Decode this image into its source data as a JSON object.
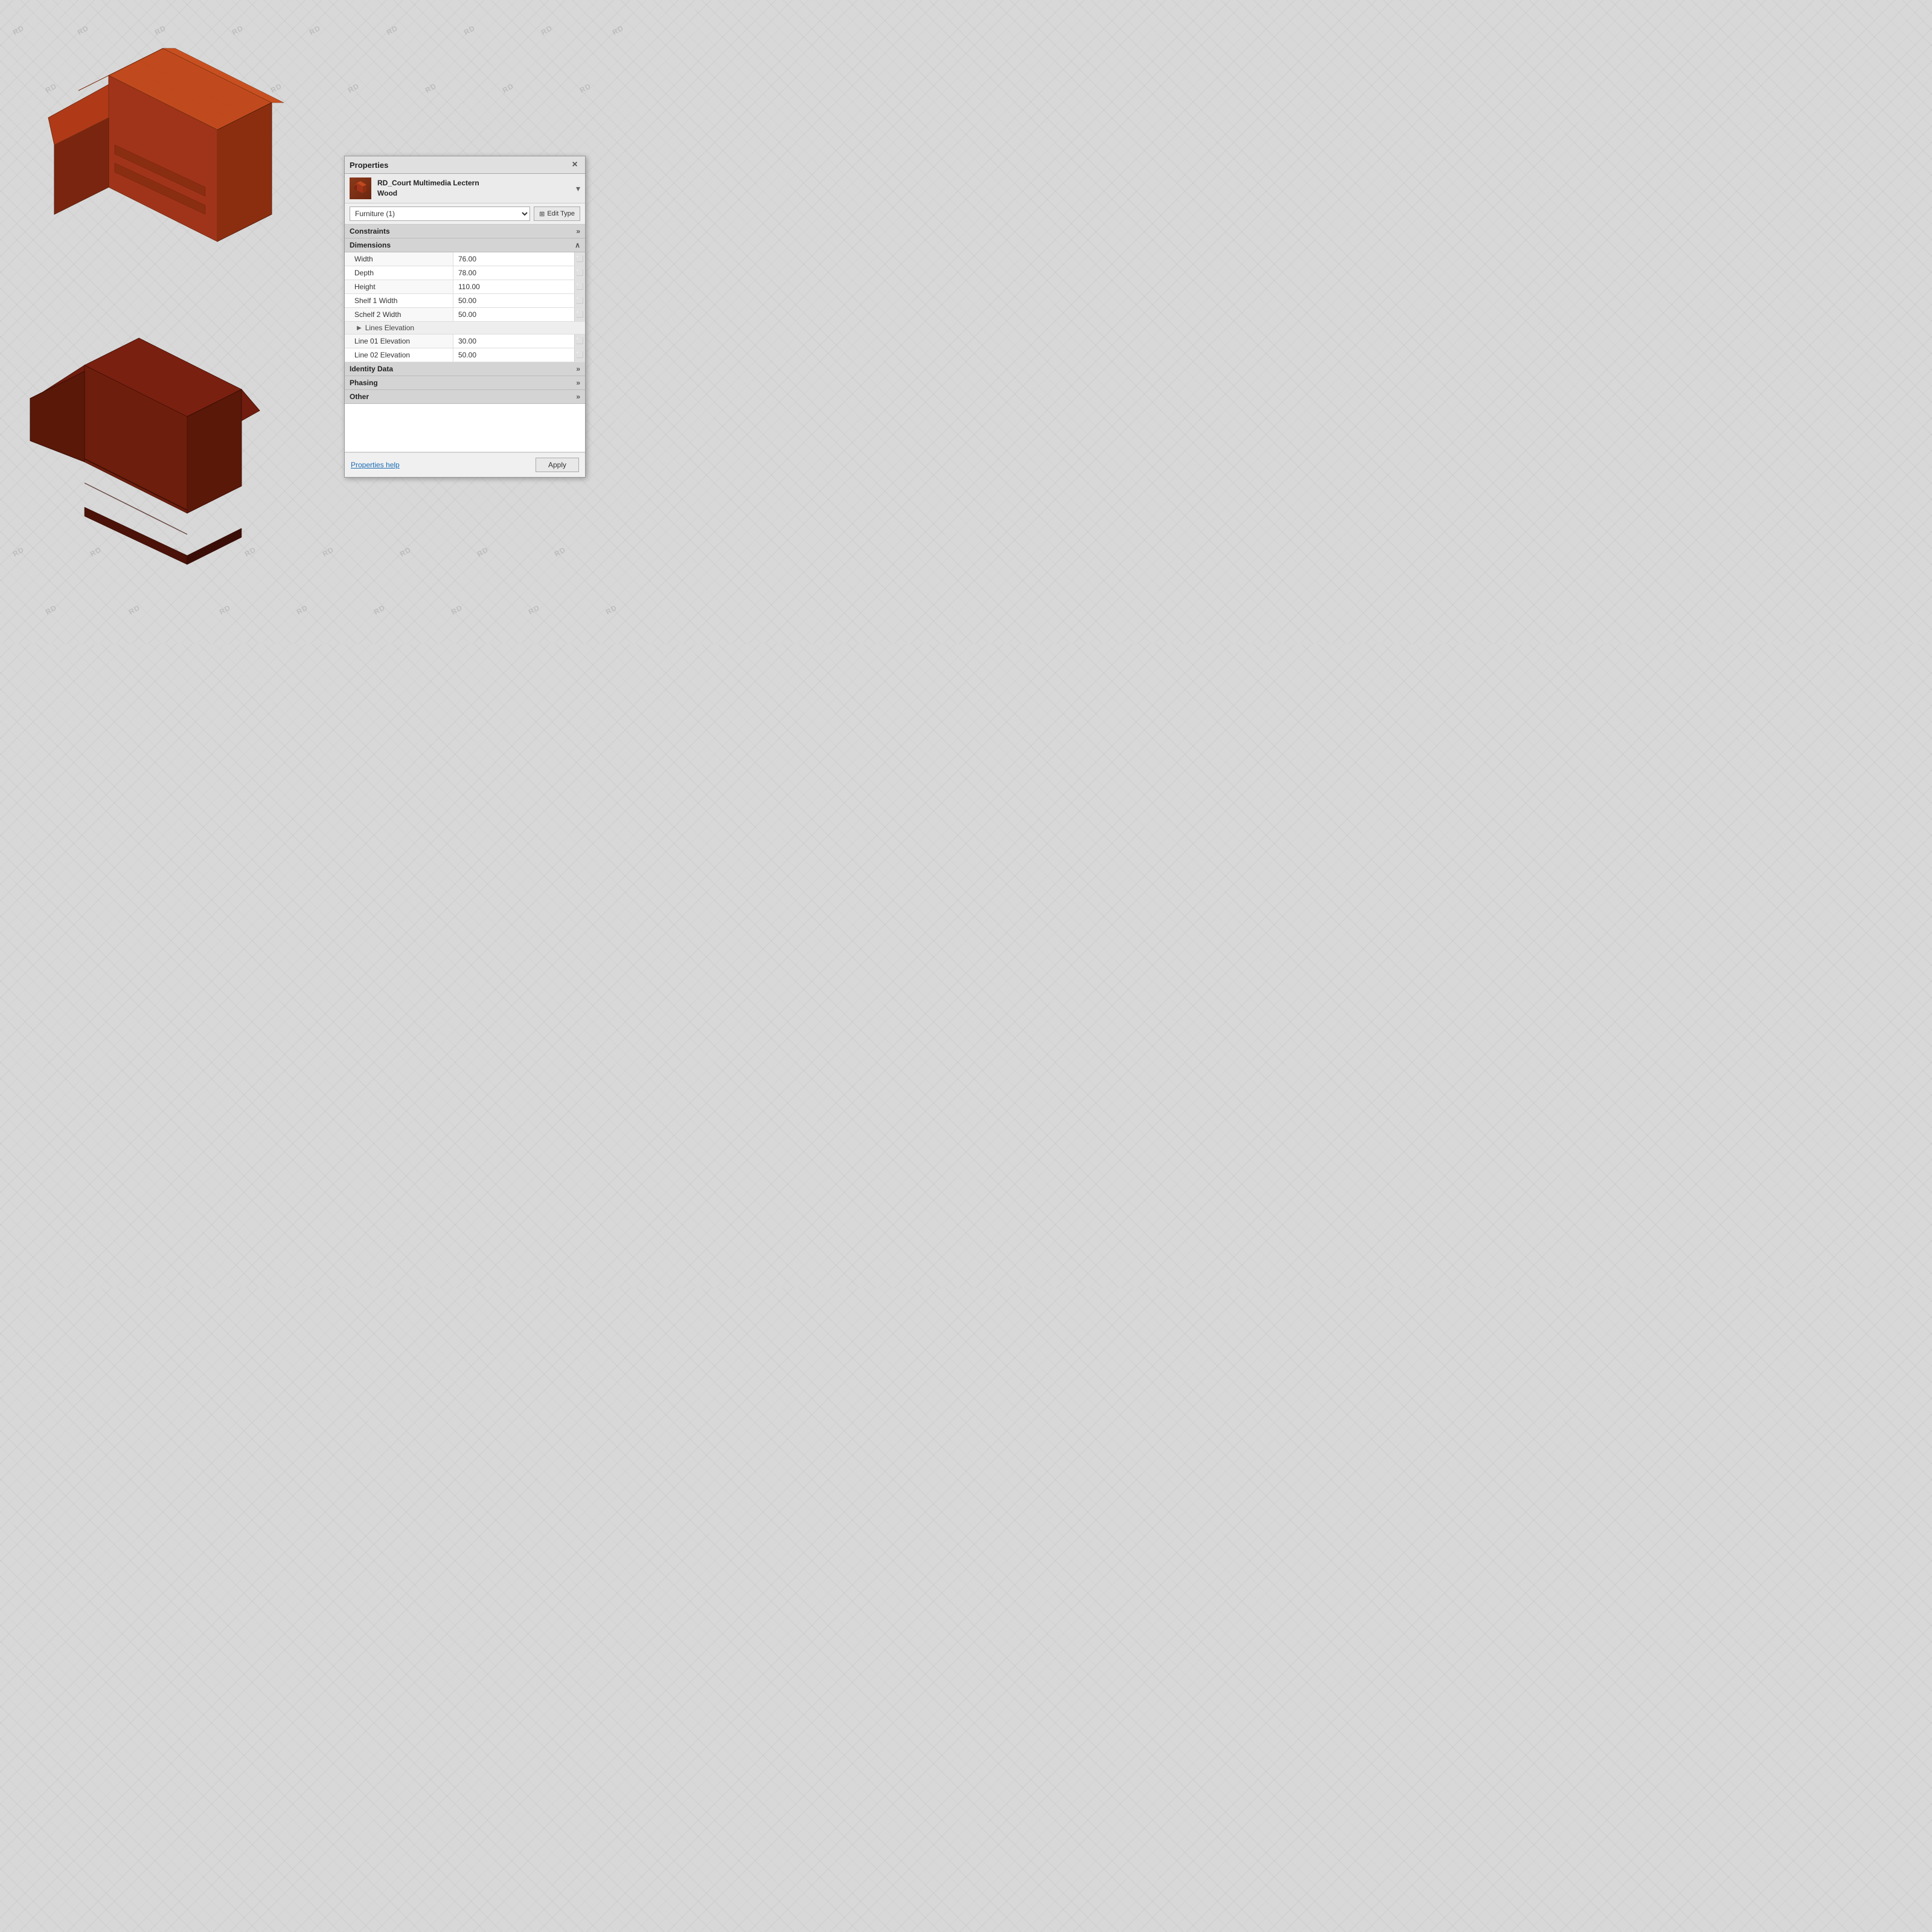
{
  "watermarks": [
    "RD",
    "RD",
    "RD",
    "RD",
    "RD",
    "RD",
    "RD",
    "RD",
    "RD",
    "RD",
    "RD",
    "RD",
    "RD",
    "RD",
    "RD",
    "RD",
    "RD",
    "RD",
    "RD",
    "RD",
    "RD",
    "RD",
    "RD",
    "RD",
    "RD",
    "RD",
    "RD",
    "RD",
    "RD",
    "RD",
    "RD",
    "RD",
    "RD",
    "RD",
    "RD",
    "RD",
    "RD",
    "RD",
    "RD",
    "RD",
    "RD",
    "RD",
    "RD",
    "RD",
    "RD",
    "RD",
    "RD",
    "RD",
    "RD",
    "RD"
  ],
  "panel": {
    "title": "Properties",
    "close_label": "×",
    "object": {
      "name_line1": "RD_Court Multimedia Lectern",
      "name_line2": "Wood"
    },
    "dropdown_value": "Furniture (1)",
    "edit_type_label": "Edit Type",
    "sections": [
      {
        "id": "constraints",
        "label": "Constraints",
        "collapsed": true,
        "chevron": "»"
      },
      {
        "id": "dimensions",
        "label": "Dimensions",
        "collapsed": false,
        "chevron": "^",
        "properties": [
          {
            "label": "Width",
            "value": "76.00"
          },
          {
            "label": "Depth",
            "value": "78.00"
          },
          {
            "label": "Height",
            "value": "110.00"
          },
          {
            "label": "Shelf 1 Width",
            "value": "50.00"
          },
          {
            "label": "Schelf 2 Width",
            "value": "50.00"
          },
          {
            "label": "Lines Elevation",
            "value": "",
            "sub_section": true
          },
          {
            "label": "Line 01 Elevation",
            "value": "30.00"
          },
          {
            "label": "Line 02 Elevation",
            "value": "50.00"
          }
        ]
      },
      {
        "id": "identity_data",
        "label": "Identity Data",
        "collapsed": true,
        "chevron": "»"
      },
      {
        "id": "phasing",
        "label": "Phasing",
        "collapsed": true,
        "chevron": "»"
      },
      {
        "id": "other",
        "label": "Other",
        "collapsed": true,
        "chevron": "»"
      }
    ],
    "footer": {
      "help_label": "Properties help",
      "apply_label": "Apply"
    }
  }
}
